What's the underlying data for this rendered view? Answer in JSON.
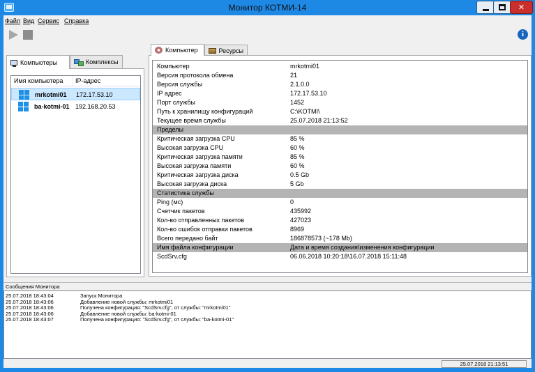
{
  "window": {
    "title": "Монитор КОТМИ-14"
  },
  "menu": {
    "items": [
      "Файл",
      "Вид",
      "Сервис",
      "Справка"
    ]
  },
  "left_tabs": [
    "Компьютеры",
    "Комплексы"
  ],
  "computers": {
    "columns": [
      "Имя компьютера",
      "IP-адрес"
    ],
    "rows": [
      {
        "name": "mrkotmi01",
        "ip": "172.17.53.10",
        "selected": true
      },
      {
        "name": "ba-kotmi-01",
        "ip": "192.168.20.53",
        "selected": false
      }
    ]
  },
  "right_tabs": [
    "Компьютер",
    "Ресурсы"
  ],
  "details": [
    {
      "key": "Компьютер",
      "value": "mrkotmi01"
    },
    {
      "key": "Версия протокола обмена",
      "value": "21"
    },
    {
      "key": "Версия службы",
      "value": "2.1.0.0"
    },
    {
      "key": "IP адрес",
      "value": "172.17.53.10"
    },
    {
      "key": "Порт службы",
      "value": "1452"
    },
    {
      "key": "Путь к хранилищу конфигураций",
      "value": "C:\\KOTMI\\"
    },
    {
      "key": "Текущее время службы",
      "value": "25.07.2018 21:13:52"
    },
    {
      "key": "Пределы",
      "value": "",
      "group": true
    },
    {
      "key": "Критическая загрузка CPU",
      "value": "85 %"
    },
    {
      "key": "Высокая загрузка CPU",
      "value": "60 %"
    },
    {
      "key": "Критическая загрузка памяти",
      "value": "85 %"
    },
    {
      "key": "Высокая загрузка памяти",
      "value": "60 %"
    },
    {
      "key": "Критическая загрузка диска",
      "value": "0.5 Gb"
    },
    {
      "key": "Высокая загрузка диска",
      "value": "5 Gb"
    },
    {
      "key": "Статистика службы",
      "value": "",
      "group": true
    },
    {
      "key": "Ping (мс)",
      "value": "0"
    },
    {
      "key": "Счетчик пакетов",
      "value": "435992"
    },
    {
      "key": "Кол-во отправленных пакетов",
      "value": "427023"
    },
    {
      "key": "Кол-во ошибок отправки пакетов",
      "value": "8969"
    },
    {
      "key": "Всего передано байт",
      "value": "186878573 (~178 Mb)"
    },
    {
      "key": "Имя файла конфигурации",
      "value": "Дата и время создания\\изменения конфигурации",
      "group": true
    },
    {
      "key": "ScdSrv.cfg",
      "value": "06.06.2018 10:20:18\\16.07.2018 15:11:48"
    }
  ],
  "messages_panel": {
    "title": "Сообщения Монитора",
    "rows": [
      {
        "time": "25.07.2018 18:43:04",
        "text": "Запуск Монитора"
      },
      {
        "time": "25.07.2018 18:43:06",
        "text": "Добавление новой службы: mrkotmi01"
      },
      {
        "time": "25.07.2018 18:43:06",
        "text": "Получена конфигурация: \"ScdSrv.cfg\", от службы: \"mrkotmi01\""
      },
      {
        "time": "25.07.2018 18:43:06",
        "text": "Добавление новой службы: ba-kotmi-01"
      },
      {
        "time": "25.07.2018 18:43:07",
        "text": "Получена конфигурация: \"ScdSrv.cfg\", от службы: \"ba-kotmi-01\""
      }
    ]
  },
  "status": {
    "time": "25.07.2018 21:13:51"
  }
}
